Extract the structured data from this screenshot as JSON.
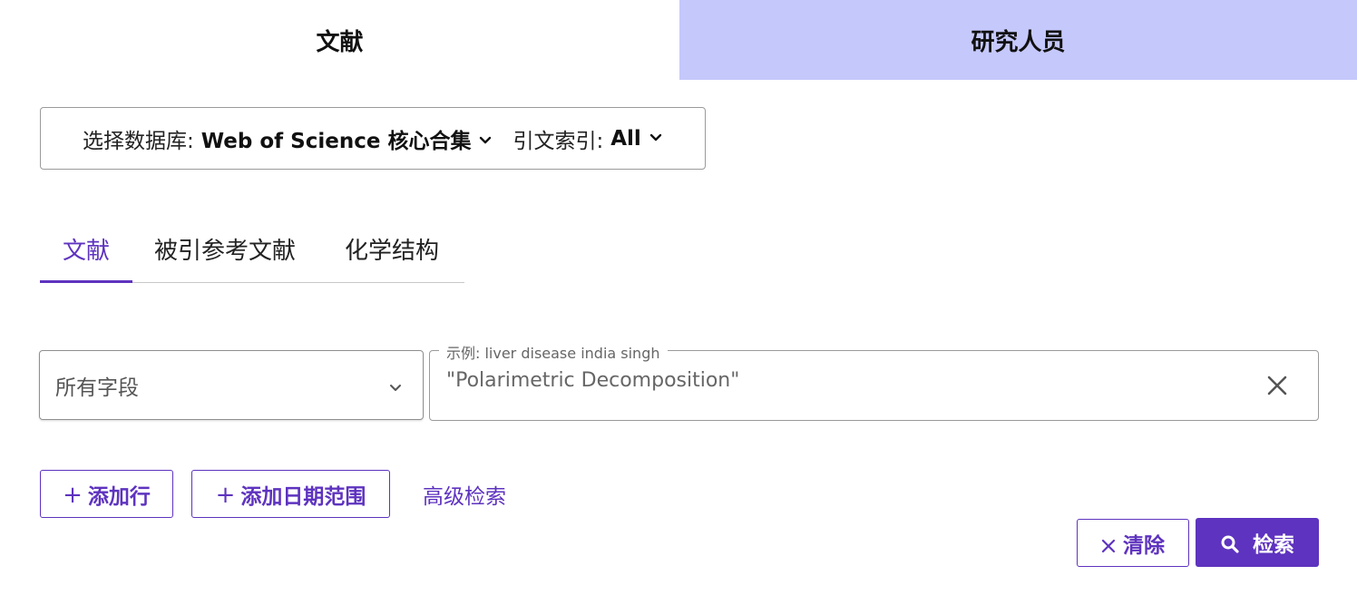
{
  "top_tabs": [
    {
      "label": "文献",
      "active": true
    },
    {
      "label": "研究人员",
      "active": false
    }
  ],
  "database": {
    "label": "选择数据库:",
    "value": "Web of Science 核心合集",
    "citation_label": "引文索引:",
    "citation_value": "All"
  },
  "sub_tabs": [
    {
      "label": "文献",
      "active": true
    },
    {
      "label": "被引参考文献",
      "active": false
    },
    {
      "label": "化学结构",
      "active": false
    }
  ],
  "search_row": {
    "field": "所有字段",
    "placeholder_legend": "示例: liver disease india singh",
    "query": "\"Polarimetric Decomposition\""
  },
  "actions": {
    "add_row": "添加行",
    "add_date_range": "添加日期范围",
    "advanced_search": "高级检索",
    "clear": "清除",
    "search": "检索",
    "plus_symbol": "+"
  },
  "colors": {
    "accent": "#5e33bf",
    "inactive_tab_bg": "#c5c8fb",
    "border": "#9a9a9a"
  },
  "icons": [
    "chevron-down-icon",
    "close-icon",
    "search-icon"
  ]
}
